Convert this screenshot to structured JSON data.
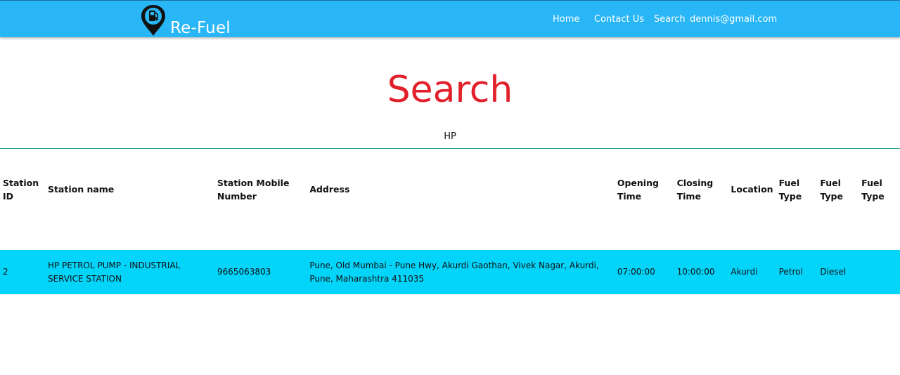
{
  "header": {
    "brand_name": "Re-Fuel",
    "brand_icon": "fuel-location-pin-icon",
    "nav": {
      "home": "Home",
      "contact": "Contact Us",
      "search": "Search",
      "user_email": "dennis@gmail.com"
    },
    "bar_color": "#29b6f6"
  },
  "main": {
    "title": "Search",
    "title_color": "#e2202b",
    "search_value": "HP"
  },
  "table": {
    "headers": {
      "station_id": "Station ID",
      "station_name": "Station name",
      "mobile": "Station Mobile Number",
      "address": "Address",
      "opening_time": "Opening Time",
      "closing_time": "Closing Time",
      "location": "Location",
      "fuel_type_1": "Fuel Type",
      "fuel_type_2": "Fuel Type",
      "fuel_type_3": "Fuel Type"
    },
    "rows": [
      {
        "station_id": "2",
        "station_name": "HP PETROL PUMP - INDUSTRIAL SERVICE STATION",
        "mobile": "9665063803",
        "address": "Pune, Old Mumbai - Pune Hwy, Akurdi Gaothan, Vivek Nagar, Akurdi, Pune, Maharashtra 411035",
        "opening_time": "07:00:00",
        "closing_time": "10:00:00",
        "location": "Akurdi",
        "fuel_type_1": "Petrol",
        "fuel_type_2": "Diesel",
        "fuel_type_3": ""
      }
    ],
    "row_color": "#03d4fa"
  }
}
